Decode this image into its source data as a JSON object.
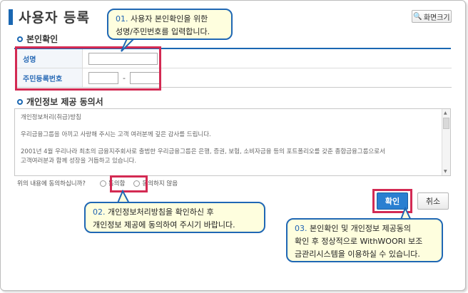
{
  "page": {
    "title": "사용자 등록",
    "zoom_label": "화면크기"
  },
  "identity": {
    "heading": "본인확인",
    "name_label": "성명",
    "rrn_label": "주민등록번호",
    "rrn_separator": "-"
  },
  "consent": {
    "heading": "개인정보 제공 동의서",
    "paragraphs": [
      "개인정보처리(취급)방침",
      "우리금융그룹을 아끼고 사랑해 주시는 고객 여러분께 깊은 감사를 드립니다.",
      "2001년 4월 우리나라 최초의 금융지주회사로 출범한 우리금융그룹은 은행, 증권, 보험, 소비자금융 등의 포트폴리오를 갖춘 종합금융그룹으로서",
      "고객여러분과 함께 성장을 거듭하고 있습니다."
    ],
    "question": "위의 내용에 동의하십니까?",
    "agree_label": "동의함",
    "disagree_label": "동의하지 않음"
  },
  "buttons": {
    "ok": "확인",
    "cancel": "취소"
  },
  "callouts": [
    {
      "num": "01.",
      "line1": "사용자 본인확인을 위한",
      "line2": "성명/주민번호를 입력합니다."
    },
    {
      "num": "02.",
      "line1": "개인정보처리방침을 확인하신 후",
      "line2": "개인정보 제공에 동의하여 주시기 바랍니다."
    },
    {
      "num": "03.",
      "line1": "본인확인 및 개인정보 제공동의",
      "line2": "확인 후 정상적으로 WithWOORI 보조",
      "line3": "금관리시스템을 이용하실 수 있습니다."
    }
  ],
  "colors": {
    "accent": "#1a67b2",
    "highlight": "#d32a53",
    "callout_bg": "#fefede"
  }
}
